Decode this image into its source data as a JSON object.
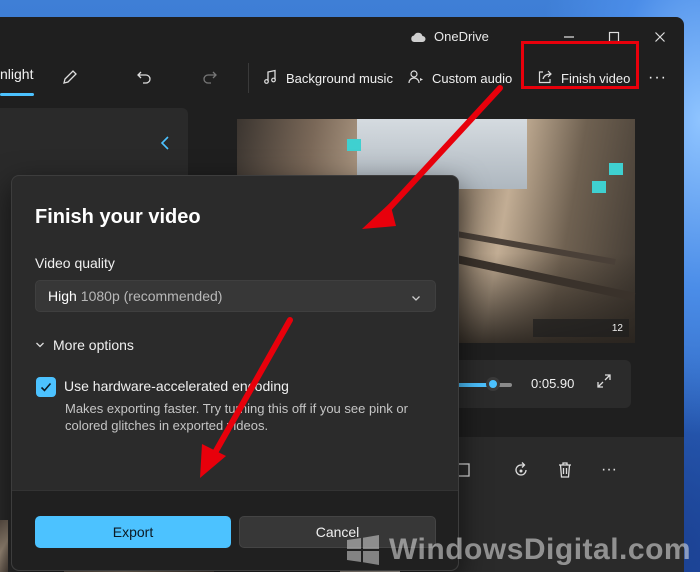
{
  "titlebar": {
    "onedrive_label": "OneDrive",
    "minimize_glyph": "—",
    "maximize_glyph": "☐",
    "close_glyph": "✕"
  },
  "toolbar": {
    "active_tab_label": "nlight",
    "background_music_label": "Background music",
    "custom_audio_label": "Custom audio",
    "finish_video_label": "Finish video",
    "more_glyph": "···"
  },
  "timeline": {
    "time": "0:05.90",
    "position": 0.66
  },
  "dialog": {
    "title": "Finish your video",
    "quality_label": "Video quality",
    "quality_value_main": "High",
    "quality_value_sub": "1080p (recommended)",
    "more_options_label": "More options",
    "hardware_checkbox_label": "Use hardware-accelerated encoding",
    "hardware_checkbox_checked": true,
    "hardware_description": "Makes exporting faster. Try turning this off if you see pink or colored glitches in exported videos.",
    "export_label": "Export",
    "cancel_label": "Cancel"
  },
  "video": {
    "hud_text": "12"
  },
  "watermark": {
    "text": "WindowsDigital.com"
  },
  "colors": {
    "accent": "#4cc2ff",
    "annotation_red": "#e8000b",
    "app_background": "#1f1f1f",
    "dialog_background": "#2b2b2b"
  },
  "icons": {
    "pencil": "pencil-icon",
    "undo": "undo-icon",
    "redo": "redo-icon",
    "music": "music-note-icon",
    "audio": "person-voice-icon",
    "share": "share-export-icon",
    "chevron_down": "chevron-down-icon",
    "check": "checkmark-icon"
  }
}
